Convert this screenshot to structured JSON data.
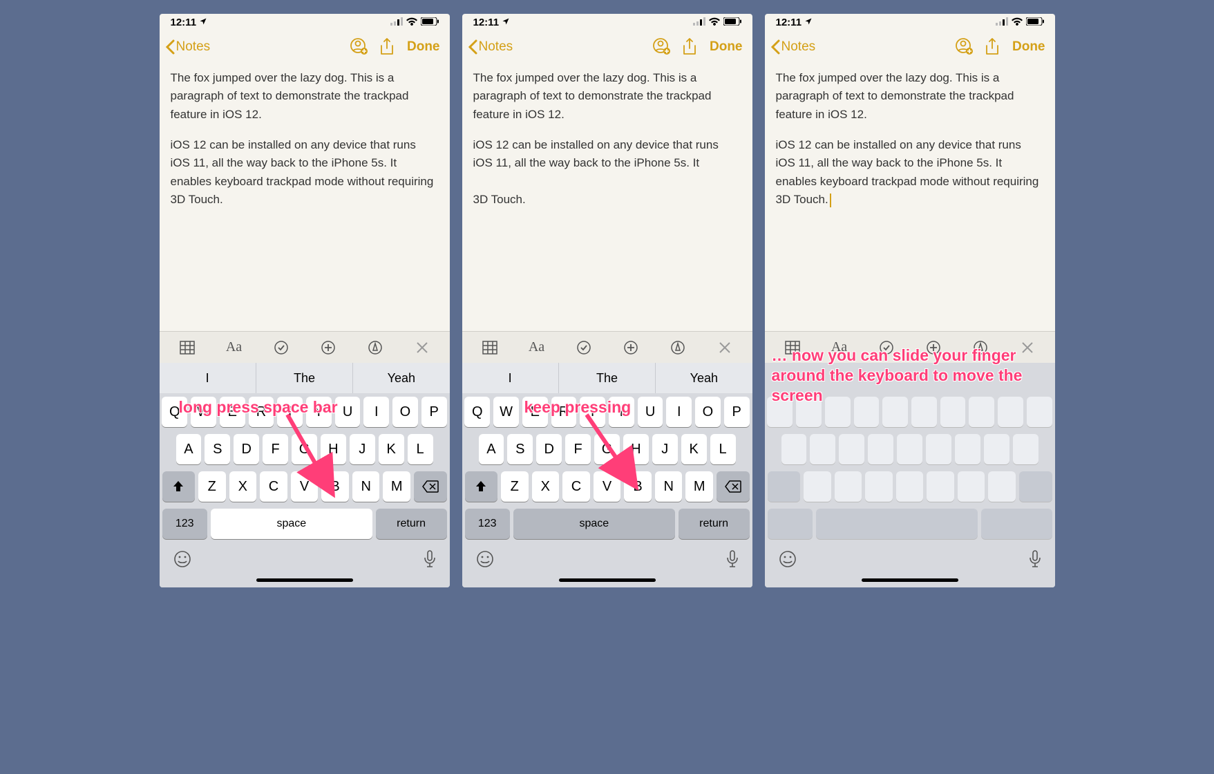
{
  "status": {
    "time": "12:11",
    "location_glyph": "➤"
  },
  "nav": {
    "back_label": "Notes",
    "done_label": "Done"
  },
  "note": {
    "p1": "The fox jumped over the lazy dog. This is a paragraph of text to demonstrate the trackpad feature in iOS 12.",
    "p2": "iOS 12 can be installed on any device that runs iOS 11, all the way back to the iPhone 5s. It enables keyboard trackpad mode without requiring 3D Touch."
  },
  "format_bar": {
    "aa_label": "Aa"
  },
  "suggestions": [
    "I",
    "The",
    "Yeah"
  ],
  "keys": {
    "row1": [
      "Q",
      "W",
      "E",
      "R",
      "T",
      "Y",
      "U",
      "I",
      "O",
      "P"
    ],
    "row2": [
      "A",
      "S",
      "D",
      "F",
      "G",
      "H",
      "J",
      "K",
      "L"
    ],
    "row3": [
      "Z",
      "X",
      "C",
      "V",
      "B",
      "N",
      "M"
    ],
    "num": "123",
    "space": "space",
    "ret": "return"
  },
  "annotations": {
    "s1": "long press space bar",
    "s2": "keep pressing",
    "s3": "… now you can slide your finger around the keyboard to move the screen"
  }
}
